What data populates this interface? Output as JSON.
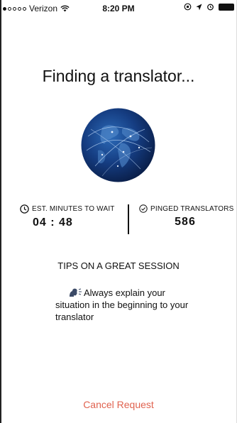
{
  "status_bar": {
    "carrier": "Verizon",
    "time": "8:20 PM",
    "signal_bars_filled": 1,
    "signal_bars_total": 5
  },
  "screen": {
    "title": "Finding a translator..."
  },
  "stats": {
    "wait_label": "EST. MINUTES TO WAIT",
    "wait_value": "04 : 48",
    "pinged_label": "PINGED TRANSLATORS",
    "pinged_value": "586"
  },
  "tips": {
    "title": "TIPS ON A GREAT SESSION",
    "tip_text": "Always explain your situation in the beginning to your translator",
    "tip_icon": "speaking-head-icon"
  },
  "actions": {
    "cancel_label": "Cancel Request"
  },
  "colors": {
    "accent": "#e0624f",
    "globe_dark": "#0a1f4a",
    "globe_light": "#2c6bb8"
  }
}
